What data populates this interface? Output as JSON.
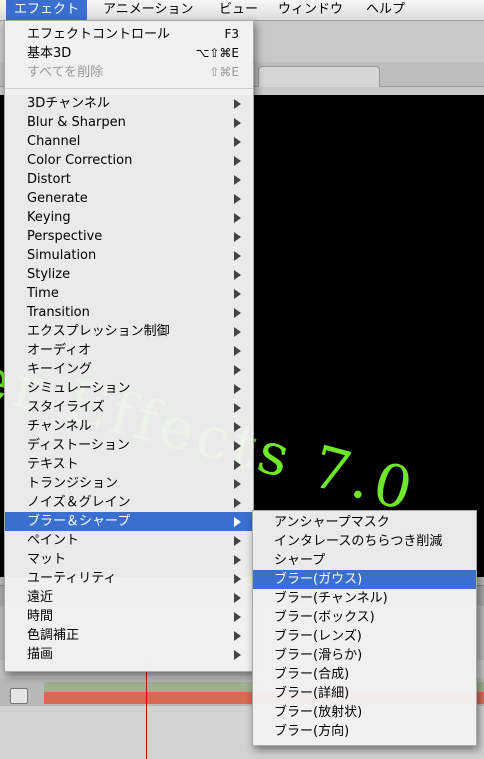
{
  "colors": {
    "menu_highlight": "#3a6fd0",
    "canvas_text": "#6fe82a",
    "canvas_bg": "#000000"
  },
  "background": {
    "canvas_text": "ter Effects 7.0"
  },
  "menubar": {
    "items": [
      {
        "label": "エフェクト",
        "active": true
      },
      {
        "label": "アニメーション"
      },
      {
        "label": "ビュー"
      },
      {
        "label": "ウィンドウ"
      },
      {
        "label": "ヘルプ"
      }
    ]
  },
  "menu": {
    "top_items": [
      {
        "label": "エフェクトコントロール",
        "shortcut": "F3"
      },
      {
        "label": "基本3D",
        "shortcut": "⌥⇧⌘E"
      },
      {
        "label": "すべてを削除",
        "shortcut": "⇧⌘E",
        "disabled": true
      }
    ],
    "categories": [
      {
        "label": "3Dチャンネル",
        "icon": "submenu-arrow"
      },
      {
        "label": "Blur & Sharpen",
        "icon": "submenu-arrow"
      },
      {
        "label": "Channel",
        "icon": "submenu-arrow"
      },
      {
        "label": "Color Correction",
        "icon": "submenu-arrow"
      },
      {
        "label": "Distort",
        "icon": "submenu-arrow"
      },
      {
        "label": "Generate",
        "icon": "submenu-arrow"
      },
      {
        "label": "Keying",
        "icon": "submenu-arrow"
      },
      {
        "label": "Perspective",
        "icon": "submenu-arrow"
      },
      {
        "label": "Simulation",
        "icon": "submenu-arrow"
      },
      {
        "label": "Stylize",
        "icon": "submenu-arrow"
      },
      {
        "label": "Time",
        "icon": "submenu-arrow"
      },
      {
        "label": "Transition",
        "icon": "submenu-arrow"
      },
      {
        "label": "エクスプレッション制御",
        "icon": "submenu-arrow"
      },
      {
        "label": "オーディオ",
        "icon": "submenu-arrow"
      },
      {
        "label": "キーイング",
        "icon": "submenu-arrow"
      },
      {
        "label": "シミュレーション",
        "icon": "submenu-arrow"
      },
      {
        "label": "スタイライズ",
        "icon": "submenu-arrow"
      },
      {
        "label": "チャンネル",
        "icon": "submenu-arrow"
      },
      {
        "label": "ディストーション",
        "icon": "submenu-arrow"
      },
      {
        "label": "テキスト",
        "icon": "submenu-arrow"
      },
      {
        "label": "トランジション",
        "icon": "submenu-arrow"
      },
      {
        "label": "ノイズ＆グレイン",
        "icon": "submenu-arrow"
      },
      {
        "label": "ブラー＆シャープ",
        "icon": "submenu-arrow",
        "highlighted": true
      },
      {
        "label": "ペイント",
        "icon": "submenu-arrow"
      },
      {
        "label": "マット",
        "icon": "submenu-arrow"
      },
      {
        "label": "ユーティリティ",
        "icon": "submenu-arrow"
      },
      {
        "label": "遠近",
        "icon": "submenu-arrow"
      },
      {
        "label": "時間",
        "icon": "submenu-arrow"
      },
      {
        "label": "色調補正",
        "icon": "submenu-arrow"
      },
      {
        "label": "描画",
        "icon": "submenu-arrow"
      }
    ]
  },
  "submenu": {
    "items": [
      {
        "label": "アンシャープマスク"
      },
      {
        "label": "インタレースのちらつき削減"
      },
      {
        "label": "シャープ"
      },
      {
        "label": "ブラー(ガウス)",
        "highlighted": true
      },
      {
        "label": "ブラー(チャンネル)"
      },
      {
        "label": "ブラー(ボックス)"
      },
      {
        "label": "ブラー(レンズ)"
      },
      {
        "label": "ブラー(滑らか)"
      },
      {
        "label": "ブラー(合成)"
      },
      {
        "label": "ブラー(詳細)"
      },
      {
        "label": "ブラー(放射状)"
      },
      {
        "label": "ブラー(方向)"
      }
    ]
  }
}
